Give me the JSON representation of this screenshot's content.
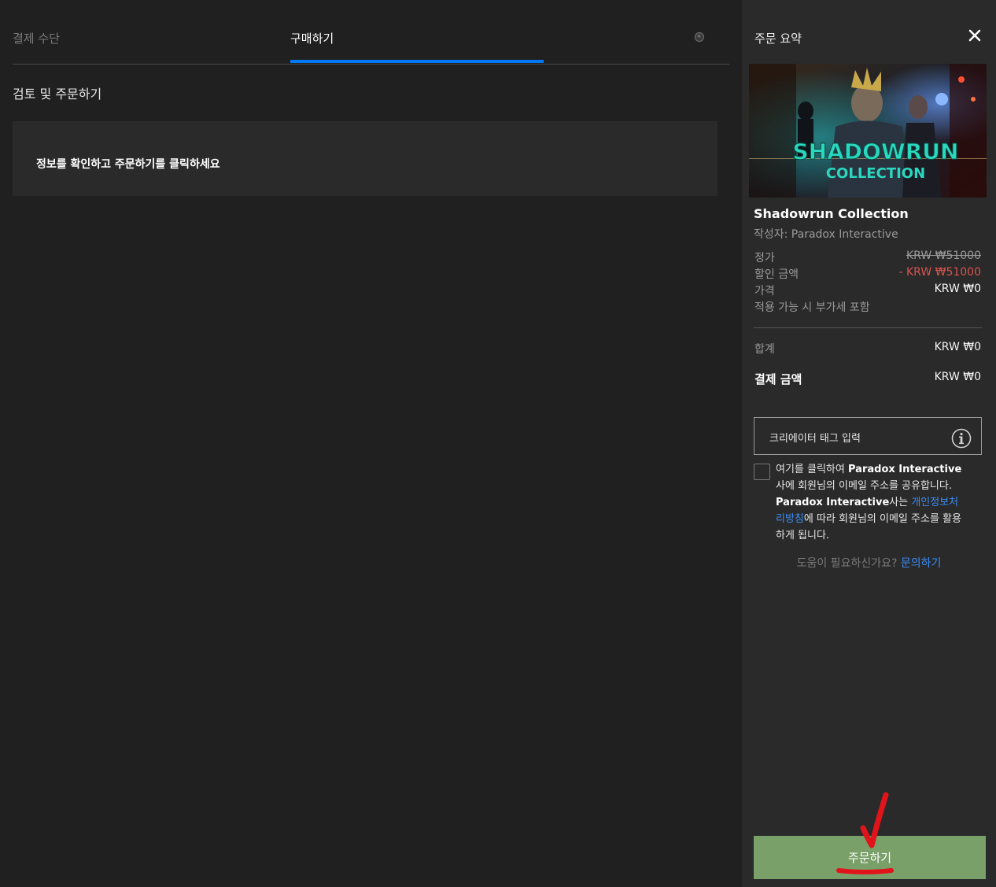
{
  "tabs": {
    "payment_label": "결제 수단",
    "purchase_label": "구매하기"
  },
  "main": {
    "section_title": "검토 및 주문하기",
    "info_text": "정보를 확인하고 주문하기를 클릭하세요"
  },
  "summary": {
    "title": "주문 요약",
    "cover_logo_line1": "SHADOWRUN",
    "cover_logo_line2": "COLLECTION",
    "game_title": "Shadowrun Collection",
    "publisher": "작성자: Paradox Interactive",
    "rows": {
      "list_price_label": "정가",
      "list_price_value": "KRW ₩51000",
      "discount_label": "할인 금액",
      "discount_value": "- KRW ₩51000",
      "price_label": "가격",
      "price_value": "KRW ₩0",
      "vat_note": "적용 가능 시 부가세 포함"
    },
    "subtotal_label": "합계",
    "subtotal_value": "KRW ₩0",
    "total_label": "결제 금액",
    "total_value": "KRW ₩0",
    "creator_tag_placeholder": "크리에이터 태그 입력",
    "consent": {
      "part1": "여기를 클릭하여 ",
      "company1": "Paradox Interactive",
      "part2": "사에 회원님의 이메일 주소를 공유합니다. ",
      "company2": "Paradox Interactive",
      "part3": "사는 ",
      "policy_link": "개인정보처리방침",
      "part4": "에 따라 회원님의 이메일 주소를 활용하게 됩니다."
    },
    "help_text": "도움이 필요하신가요? ",
    "help_link": "문의하기",
    "order_button": "주문하기"
  },
  "colors": {
    "background": "#202020",
    "sidebar": "#2a2a2a",
    "accent_blue": "#0078f2",
    "link_blue": "#3b8df5",
    "discount_red": "#d9534f",
    "order_green": "#7aa069",
    "annotation_red": "#e0141a"
  }
}
